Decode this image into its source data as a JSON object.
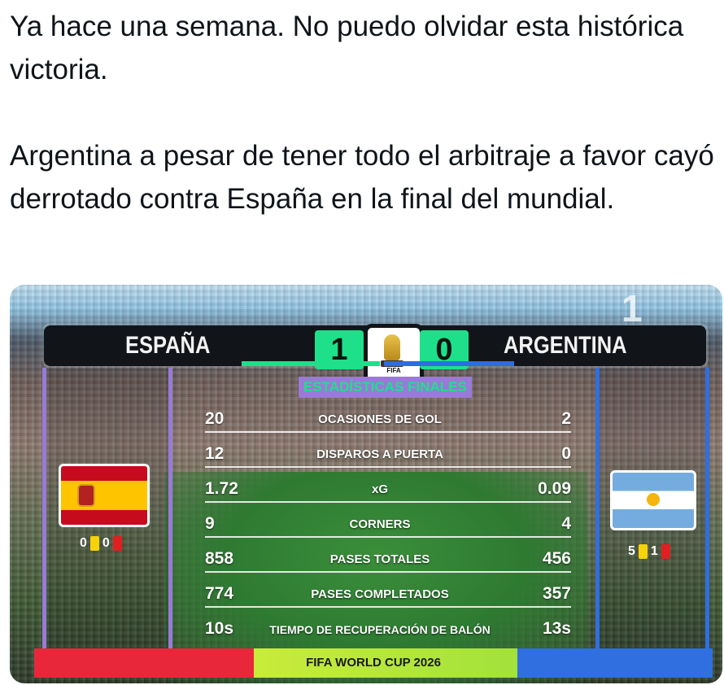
{
  "tweet": {
    "paragraph_1": "Ya hace una semana. No puedo olvidar esta histórica victoria.",
    "paragraph_2": "Argentina a pesar de tener todo el arbitraje a favor cayó derrotado contra España en la final del mundial."
  },
  "broadcast": {
    "corner_number": "1",
    "team_left": "ESPAÑA",
    "team_right": "ARGENTINA",
    "score_left": "1",
    "score_right": "0",
    "trophy_label": "FIFA",
    "stats_title": "ESTADÍSTICAS FINALES",
    "stats": [
      {
        "left": "20",
        "label": "OCASIONES DE GOL",
        "right": "2"
      },
      {
        "left": "12",
        "label": "DISPAROS A PUERTA",
        "right": "0"
      },
      {
        "left": "1.72",
        "label": "xG",
        "right": "0.09"
      },
      {
        "left": "9",
        "label": "CORNERS",
        "right": "4"
      },
      {
        "left": "858",
        "label": "PASES TOTALES",
        "right": "456"
      },
      {
        "left": "774",
        "label": "PASES COMPLETADOS",
        "right": "357"
      },
      {
        "left": "10s",
        "label": "TIEMPO DE RECUPERACIÓN DE BALÓN",
        "right": "13s"
      }
    ],
    "cards_left": {
      "yellow": "0",
      "red": "0"
    },
    "cards_right": {
      "yellow": "5",
      "red": "1"
    },
    "footer": "FIFA WORLD CUP 2026",
    "colors": {
      "accent_green": "#1ee08a",
      "spain_purple": "#9a7ad8",
      "argentina_blue": "#2f6fe0",
      "footer_red": "#e8283a",
      "footer_lime": "#c9ec3a"
    }
  }
}
